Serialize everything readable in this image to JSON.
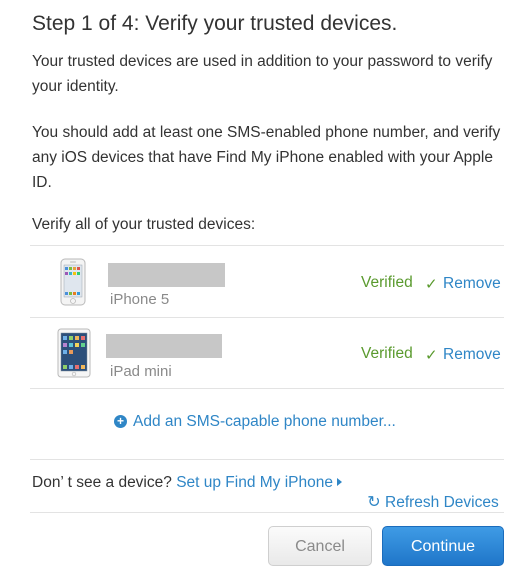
{
  "header": {
    "title": "Step 1 of 4: Verify your trusted devices."
  },
  "intro": {
    "paragraph1": "Your trusted devices are used in addition to your password to verify your identity.",
    "paragraph2": "You should add at least one SMS-enabled phone number, and verify any iOS devices that have Find My iPhone enabled with your Apple ID."
  },
  "devices_section": {
    "label": "Verify all of your trusted devices:",
    "devices": [
      {
        "model": "iPhone 5",
        "status": "Verified",
        "status_icon": "checkmark-icon",
        "action": "Remove"
      },
      {
        "model": "iPad mini",
        "status": "Verified",
        "status_icon": "checkmark-icon",
        "action": "Remove"
      }
    ],
    "add_link": "Add an SMS-capable phone number..."
  },
  "footer": {
    "no_device_prefix": "Don’ t see a device?",
    "setup_link": "Set up Find My iPhone",
    "refresh_label": "Refresh Devices"
  },
  "buttons": {
    "cancel": "Cancel",
    "continue": "Continue"
  },
  "colors": {
    "link": "#2f86c6",
    "verified": "#5a9a2e",
    "primary_button": "#1f76c9"
  }
}
